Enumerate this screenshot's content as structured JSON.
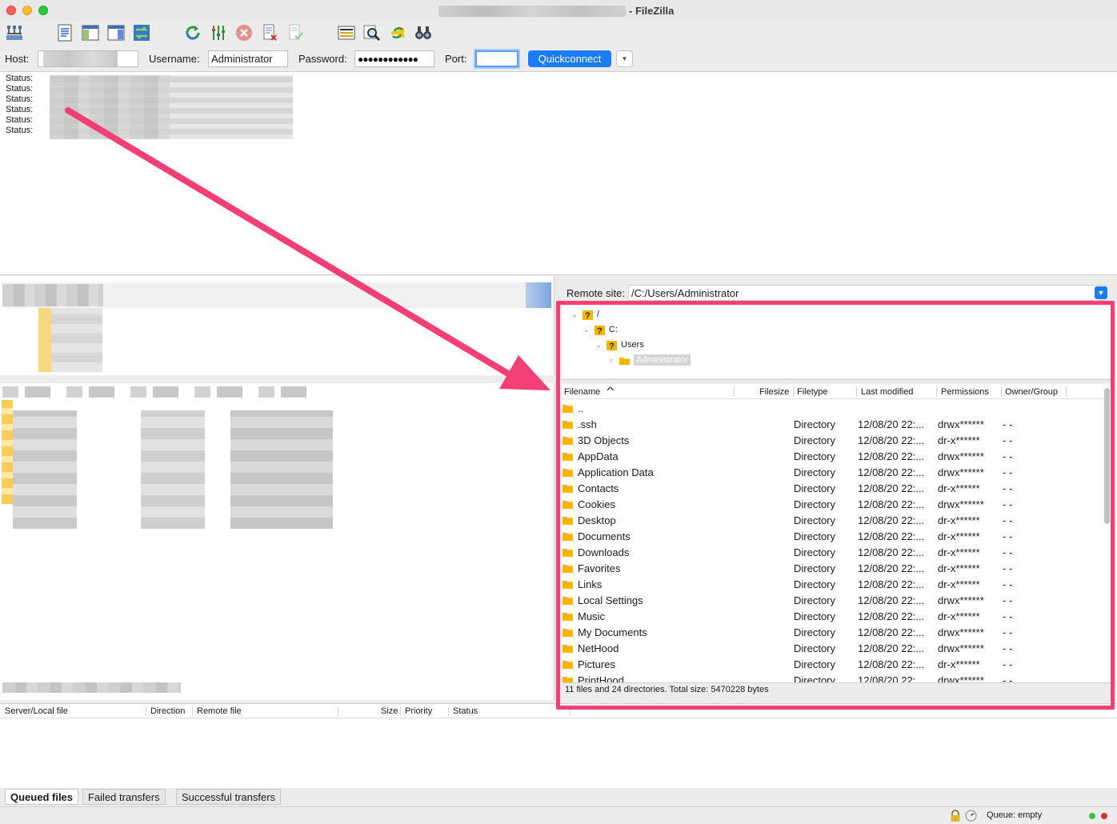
{
  "window": {
    "title": "- FileZilla"
  },
  "toolbar": {
    "icons": [
      "site-manager-icon",
      "message-log-icon",
      "local-tree-icon",
      "remote-tree-icon",
      "transfer-queue-icon",
      "refresh-icon",
      "process-queue-icon",
      "cancel-icon",
      "disconnect-icon",
      "reconnect-icon",
      "directory-listing-filter-icon",
      "search-icon",
      "sync-browsing-icon",
      "compare-icon"
    ]
  },
  "quickconnect": {
    "host_label": "Host:",
    "username_label": "Username:",
    "username_value": "Administrator",
    "password_label": "Password:",
    "password_value": "●●●●●●●●●●●●",
    "port_label": "Port:",
    "port_value": "",
    "button_label": "Quickconnect",
    "dropdown_glyph": "▾"
  },
  "message_log": {
    "lines": [
      "Status:",
      "Status:",
      "Status:",
      "Status:",
      "Status:",
      "Status:"
    ]
  },
  "remote": {
    "label": "Remote site:",
    "path": "/C:/Users/Administrator",
    "tree": [
      {
        "label": "/",
        "icon": "unknown-folder-icon"
      },
      {
        "label": "C:",
        "icon": "unknown-folder-icon"
      },
      {
        "label": "Users",
        "icon": "unknown-folder-icon"
      },
      {
        "label": "Administrator",
        "icon": "folder-icon",
        "selected": true
      }
    ],
    "columns": [
      "Filename",
      "Filesize",
      "Filetype",
      "Last modified",
      "Permissions",
      "Owner/Group"
    ],
    "sort_glyph": "^",
    "rows": [
      {
        "name": "..",
        "type": "",
        "modified": "",
        "perm": "",
        "owner": ""
      },
      {
        "name": ".ssh",
        "type": "Directory",
        "modified": "12/08/20 22:...",
        "perm": "drwx******",
        "owner": "- -"
      },
      {
        "name": "3D Objects",
        "type": "Directory",
        "modified": "12/08/20 22:...",
        "perm": "dr-x******",
        "owner": "- -"
      },
      {
        "name": "AppData",
        "type": "Directory",
        "modified": "12/08/20 22:...",
        "perm": "drwx******",
        "owner": "- -"
      },
      {
        "name": "Application Data",
        "type": "Directory",
        "modified": "12/08/20 22:...",
        "perm": "drwx******",
        "owner": "- -"
      },
      {
        "name": "Contacts",
        "type": "Directory",
        "modified": "12/08/20 22:...",
        "perm": "dr-x******",
        "owner": "- -"
      },
      {
        "name": "Cookies",
        "type": "Directory",
        "modified": "12/08/20 22:...",
        "perm": "drwx******",
        "owner": "- -"
      },
      {
        "name": "Desktop",
        "type": "Directory",
        "modified": "12/08/20 22:...",
        "perm": "dr-x******",
        "owner": "- -"
      },
      {
        "name": "Documents",
        "type": "Directory",
        "modified": "12/08/20 22:...",
        "perm": "dr-x******",
        "owner": "- -"
      },
      {
        "name": "Downloads",
        "type": "Directory",
        "modified": "12/08/20 22:...",
        "perm": "dr-x******",
        "owner": "- -"
      },
      {
        "name": "Favorites",
        "type": "Directory",
        "modified": "12/08/20 22:...",
        "perm": "dr-x******",
        "owner": "- -"
      },
      {
        "name": "Links",
        "type": "Directory",
        "modified": "12/08/20 22:...",
        "perm": "dr-x******",
        "owner": "- -"
      },
      {
        "name": "Local Settings",
        "type": "Directory",
        "modified": "12/08/20 22:...",
        "perm": "drwx******",
        "owner": "- -"
      },
      {
        "name": "Music",
        "type": "Directory",
        "modified": "12/08/20 22:...",
        "perm": "dr-x******",
        "owner": "- -"
      },
      {
        "name": "My Documents",
        "type": "Directory",
        "modified": "12/08/20 22:...",
        "perm": "drwx******",
        "owner": "- -"
      },
      {
        "name": "NetHood",
        "type": "Directory",
        "modified": "12/08/20 22:...",
        "perm": "drwx******",
        "owner": "- -"
      },
      {
        "name": "Pictures",
        "type": "Directory",
        "modified": "12/08/20 22:...",
        "perm": "dr-x******",
        "owner": "- -"
      },
      {
        "name": "PrintHood",
        "type": "Directory",
        "modified": "12/08/20 22:...",
        "perm": "drwx******",
        "owner": "- -"
      }
    ],
    "status": "11 files and 24 directories. Total size: 5470228 bytes"
  },
  "queue": {
    "columns": [
      "Server/Local file",
      "Direction",
      "Remote file",
      "Size",
      "Priority",
      "Status"
    ],
    "tabs": [
      "Queued files",
      "Failed transfers",
      "Successful transfers"
    ],
    "status": "Queue: empty"
  },
  "colors": {
    "accent": "#1b7cf7",
    "annotation": "#f43f75",
    "folder": "#f7b500"
  }
}
